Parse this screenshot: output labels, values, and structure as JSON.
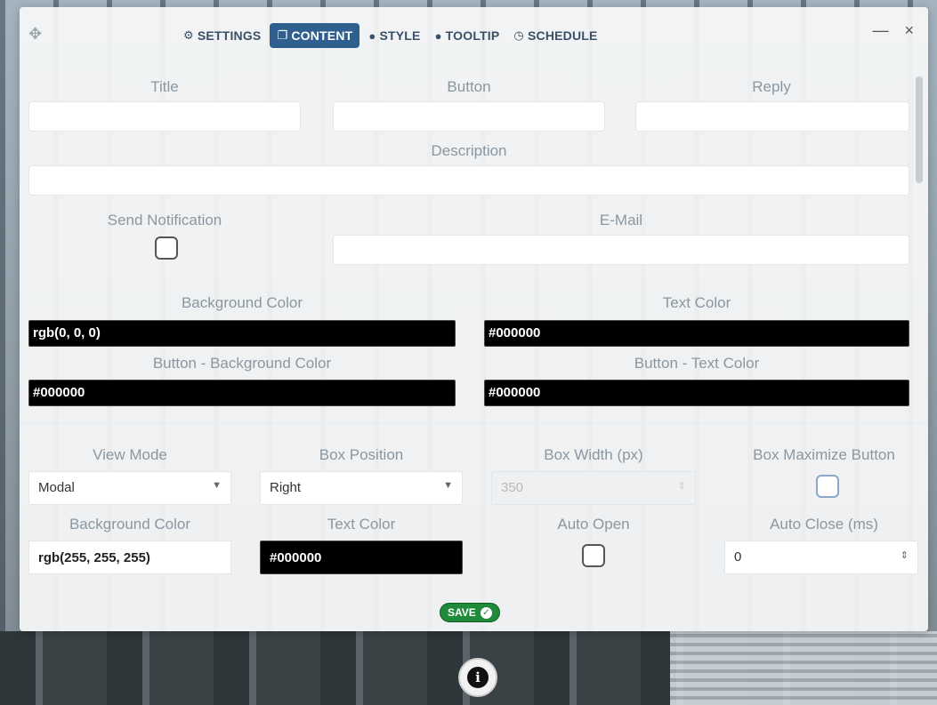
{
  "tabs": [
    {
      "label": "SETTINGS",
      "icon": "gear-icon"
    },
    {
      "label": "CONTENT",
      "icon": "window-icon",
      "active": true
    },
    {
      "label": "STYLE",
      "icon": "palette-icon"
    },
    {
      "label": "TOOLTIP",
      "icon": "speech-bubble-icon"
    },
    {
      "label": "SCHEDULE",
      "icon": "clock-icon"
    }
  ],
  "window": {
    "minimize": "—",
    "close": "×"
  },
  "fields": {
    "title_label": "Title",
    "button_label": "Button",
    "reply_label": "Reply",
    "description_label": "Description",
    "send_notification_label": "Send Notification",
    "email_label": "E-Mail",
    "bg_color_label": "Background Color",
    "bg_color_value": "rgb(0, 0, 0)",
    "text_color_label": "Text Color",
    "text_color_value": "#000000",
    "button_bg_color_label": "Button - Background Color",
    "button_bg_color_value": "#000000",
    "button_text_color_label": "Button - Text Color",
    "button_text_color_value": "#000000",
    "view_mode_label": "View Mode",
    "view_mode_value": "Modal",
    "box_position_label": "Box Position",
    "box_position_value": "Right",
    "box_width_label": "Box Width (px)",
    "box_width_value": "350",
    "box_maximize_label": "Box Maximize Button",
    "box_bg_color_label": "Background Color",
    "box_bg_color_value": "rgb(255, 255, 255)",
    "box_text_color_label": "Text Color",
    "box_text_color_value": "#000000",
    "auto_open_label": "Auto Open",
    "auto_close_label": "Auto Close (ms)",
    "auto_close_value": "0"
  },
  "save_label": "SAVE",
  "colors": {
    "accent": "#2f5f8f",
    "save": "#1f8a3a"
  }
}
